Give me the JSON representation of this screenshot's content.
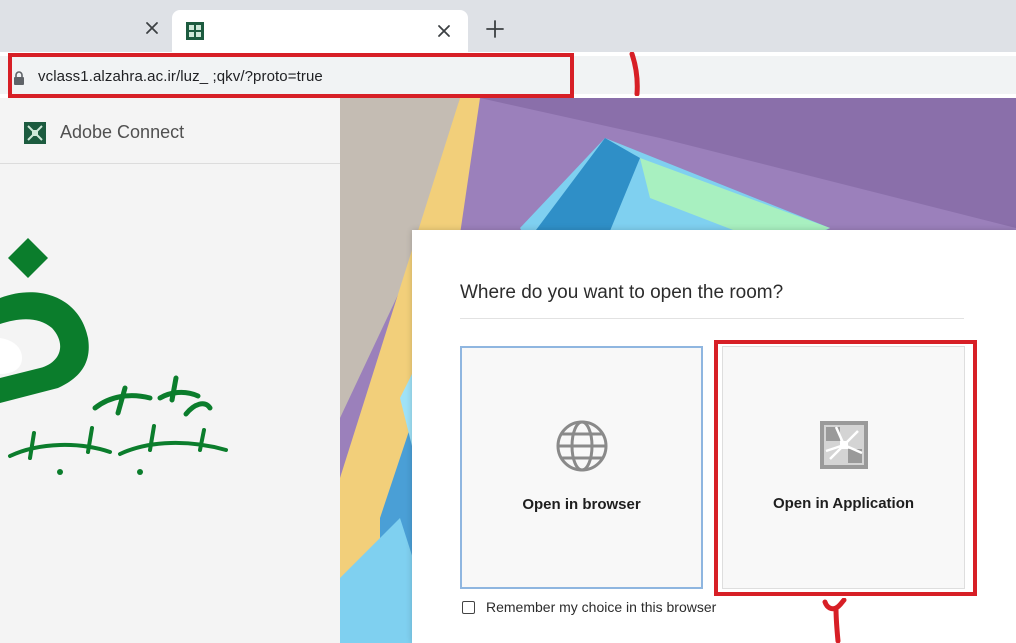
{
  "browser": {
    "address_url": "vclass1.alzahra.ac.ir/luz_   ;qkv/?proto=true",
    "tab_close_glyph": "×",
    "new_tab_glyph": "+",
    "icons": [
      "close-icon",
      "adobe-connect-favicon",
      "plus-icon",
      "lock-icon"
    ]
  },
  "annotations": {
    "step_one": "۱",
    "step_two": "۲",
    "highlight_color": "#d71f26"
  },
  "sidebar": {
    "app_title": "Adobe Connect",
    "logo": "alzahra-university-logo"
  },
  "dialog": {
    "title": "Where do you want to open the room?",
    "options": [
      {
        "label": "Open in browser",
        "icon": "globe-icon"
      },
      {
        "label": "Open in Application",
        "icon": "adobe-connect-app-icon"
      }
    ],
    "remember_label": "Remember my choice in this browser",
    "remember_checked": false
  },
  "colors": {
    "accent_green": "#0b7d2c",
    "dialog_bg": "#ffffff",
    "browser_border": "#8fb6e0"
  }
}
